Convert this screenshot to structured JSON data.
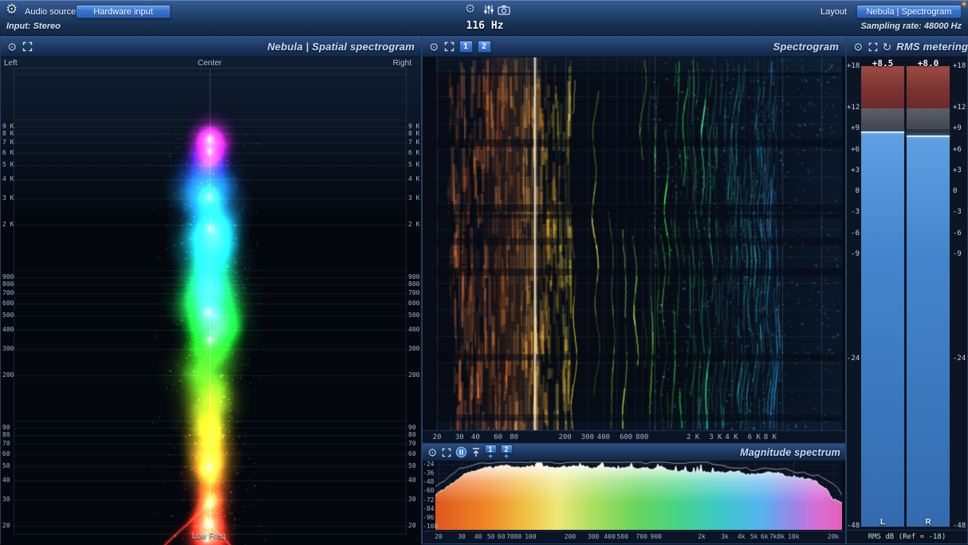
{
  "theme": {
    "accent": "#3f7fd6",
    "panel_title_color": "#c9dcf2",
    "led_color": "#f0a532"
  },
  "icons": {
    "gear": "⚙",
    "refresh": "↻",
    "plus": "+"
  },
  "topbar": {
    "audio_source_label": "Audio source",
    "hardware_input_button": "Hardware input",
    "input_info": "Input: Stereo",
    "frequency_readout": "116 Hz",
    "layout_button": "Layout",
    "view_preset_button": "Nebula | Spectrogram",
    "sampling_rate": "Sampling rate: 48000 Hz"
  },
  "spatial": {
    "title": "Nebula | Spatial spectrogram",
    "top_left": "Left",
    "top_center": "Center",
    "top_right": "Right",
    "bottom_label": "Low Freq.",
    "freq_ticks": [
      "9 K",
      "8 K",
      "7 K",
      "6 K",
      "5 K",
      "4 K",
      "3 K",
      "2 K",
      "900",
      "800",
      "700",
      "600",
      "500",
      "400",
      "300",
      "200",
      "90",
      "80",
      "70",
      "60",
      "50",
      "40",
      "30",
      "20"
    ]
  },
  "spectrogram": {
    "title": "Spectrogram",
    "view_buttons": [
      "1",
      "2"
    ],
    "cursor_frequency_hz": 116,
    "freq_ticks": [
      "20",
      "30",
      "40",
      "60",
      "80",
      "200",
      "300",
      "400",
      "600",
      "800",
      "2 K",
      "3 K",
      "4 K",
      "6 K",
      "8 K"
    ]
  },
  "magnitude": {
    "title": "Magnitude spectrum",
    "view_buttons": [
      "1",
      "2"
    ],
    "db_ticks": [
      "-24",
      "-36",
      "-48",
      "-60",
      "-72",
      "-84",
      "-96",
      "-108"
    ],
    "freq_ticks": [
      "20",
      "30",
      "40",
      "50",
      "60",
      "70",
      "80",
      "100",
      "200",
      "300",
      "400",
      "500",
      "700",
      "900",
      "2k",
      "3k",
      "4k",
      "5k",
      "6k",
      "7k",
      "8k",
      "10k",
      "20k"
    ]
  },
  "rms": {
    "title": "RMS metering",
    "value_left": "+8.5",
    "value_right": "+8.0",
    "scale_ticks": [
      "+18",
      "+12",
      "+9",
      "+6",
      "+3",
      "0",
      "-3",
      "-6",
      "-9",
      "-24",
      "-48"
    ],
    "channel_left": "L",
    "channel_right": "R",
    "footer": "RMS dB (Ref = -18)"
  }
}
